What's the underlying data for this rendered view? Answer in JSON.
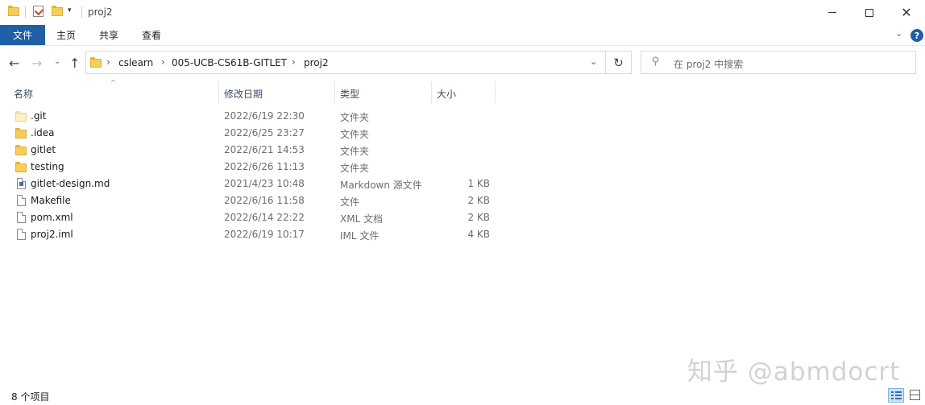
{
  "window": {
    "title": "proj2"
  },
  "ribbon": {
    "tabs": [
      "文件",
      "主页",
      "共享",
      "查看"
    ],
    "help_label": "?"
  },
  "address": {
    "breadcrumbs": [
      "cslearn",
      "005-UCB-CS61B-GITLET",
      "proj2"
    ]
  },
  "search": {
    "placeholder": "在 proj2 中搜索"
  },
  "columns": {
    "name": "名称",
    "modified": "修改日期",
    "type": "类型",
    "size": "大小"
  },
  "files": [
    {
      "name": ".git",
      "modified": "2022/6/19 22:30",
      "type": "文件夹",
      "size": "",
      "icon": "folder-light-icon"
    },
    {
      "name": ".idea",
      "modified": "2022/6/25 23:27",
      "type": "文件夹",
      "size": "",
      "icon": "folder-icon"
    },
    {
      "name": "gitlet",
      "modified": "2022/6/21 14:53",
      "type": "文件夹",
      "size": "",
      "icon": "folder-icon"
    },
    {
      "name": "testing",
      "modified": "2022/6/26 11:13",
      "type": "文件夹",
      "size": "",
      "icon": "folder-icon"
    },
    {
      "name": "gitlet-design.md",
      "modified": "2021/4/23 10:48",
      "type": "Markdown 源文件",
      "size": "1 KB",
      "icon": "markdown-file-icon"
    },
    {
      "name": "Makefile",
      "modified": "2022/6/16 11:58",
      "type": "文件",
      "size": "2 KB",
      "icon": "file-icon"
    },
    {
      "name": "pom.xml",
      "modified": "2022/6/14 22:22",
      "type": "XML 文档",
      "size": "2 KB",
      "icon": "file-icon"
    },
    {
      "name": "proj2.iml",
      "modified": "2022/6/19 10:17",
      "type": "IML 文件",
      "size": "4 KB",
      "icon": "file-icon"
    }
  ],
  "status": {
    "item_count": "8 个项目"
  },
  "watermark": "知乎 @abmdocrt",
  "colors": {
    "accent": "#1f5fa6",
    "folder": "#f6cf59"
  }
}
